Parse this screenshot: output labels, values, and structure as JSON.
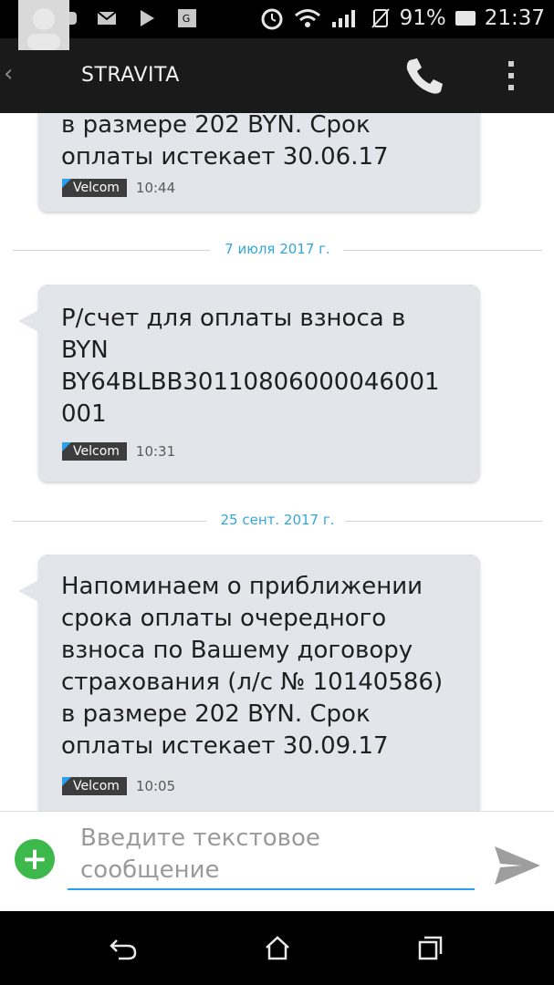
{
  "status_bar": {
    "battery_percent": "91%",
    "time": "21:37",
    "left_icons": [
      "b-app-icon",
      "youtube-icon",
      "mail-icon",
      "play-store-icon",
      "maps-icon"
    ],
    "right_icons": [
      "alarm-icon",
      "wifi-icon",
      "signal-icon",
      "no-sim-icon",
      "battery-icon"
    ]
  },
  "header": {
    "contact_name": "STRAVITA"
  },
  "messages": [
    {
      "text": "в размере 202 BYN. Срок\nоплаты истекает 30.06.17",
      "sim": "Velcom",
      "time": "10:44"
    },
    {
      "date": "7 июля 2017 г.",
      "text": "Р/счет для оплаты взноса в\nBYN\nBY64BLBB30110806000046001\n001",
      "sim": "Velcom",
      "time": "10:31"
    },
    {
      "date": "25 сент. 2017 г.",
      "text": "Напоминаем о приближении\nсрока оплаты очередного\nвзноса по Вашему договору\nстрахования (л/с № 10140586)\nв размере 202 BYN. Срок\nоплаты истекает 30.09.17",
      "sim": "Velcom",
      "time": "10:05"
    }
  ],
  "composer": {
    "placeholder": "Введите текстовое\nсообщение"
  },
  "colors": {
    "accent": "#2aa0ee",
    "bubble": "#e2e6ea",
    "date_text": "#33a6dc",
    "add_button": "#3db84a"
  }
}
